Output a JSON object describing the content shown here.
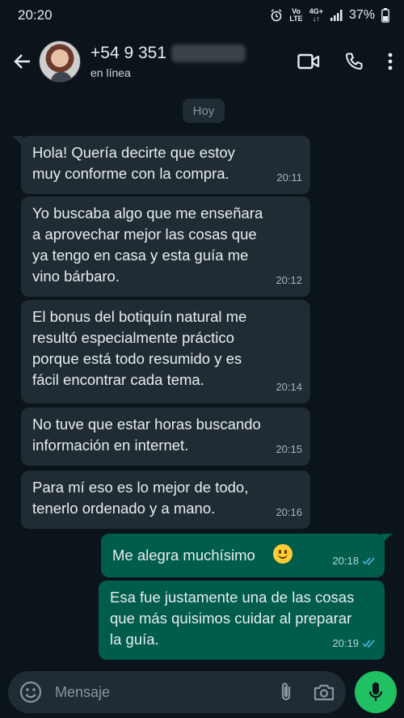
{
  "status_bar": {
    "time": "20:20",
    "network_top": "Vo",
    "network_bottom": "LTE",
    "signal_top": "4G+",
    "battery": "37%"
  },
  "header": {
    "phone_number": "+54 9 351",
    "status": "en línea"
  },
  "chat": {
    "day_label": "Hoy",
    "messages": [
      {
        "direction": "in",
        "line1": "Hola! Quería decirte que estoy",
        "line2": "muy conforme con la compra.",
        "time": "20:11"
      },
      {
        "direction": "in",
        "line1": "Yo buscaba algo que me enseñara",
        "line2": "a aprovechar mejor las cosas que",
        "line3": "ya tengo en casa y esta guía me",
        "line4": "vino bárbaro.",
        "time": "20:12"
      },
      {
        "direction": "in",
        "line1": "El bonus del botiquín natural me",
        "line2": "resultó especialmente práctico",
        "line3": "porque está todo resumido y es",
        "line4": "fácil encontrar cada tema.",
        "time": "20:14"
      },
      {
        "direction": "in",
        "line1": "No tuve que estar horas buscando",
        "line2": "información en internet.",
        "time": "20:15"
      },
      {
        "direction": "in",
        "line1": "Para mí eso es lo mejor de todo,",
        "line2": "tenerlo ordenado y a mano.",
        "time": "20:16"
      },
      {
        "direction": "out",
        "line1": "Me alegra muchísimo",
        "time": "20:18"
      },
      {
        "direction": "out",
        "line1": "Esa fue justamente una de las cosas",
        "line2": "que más quisimos cuidar al preparar",
        "line3": "la guía.",
        "time": "20:19"
      }
    ]
  },
  "input": {
    "placeholder": "Mensaje"
  },
  "colors": {
    "background": "#0b141a",
    "incoming_bubble": "#202c33",
    "outgoing_bubble": "#005c4b",
    "mic_button": "#21c063",
    "read_ticks": "#53bdeb"
  }
}
